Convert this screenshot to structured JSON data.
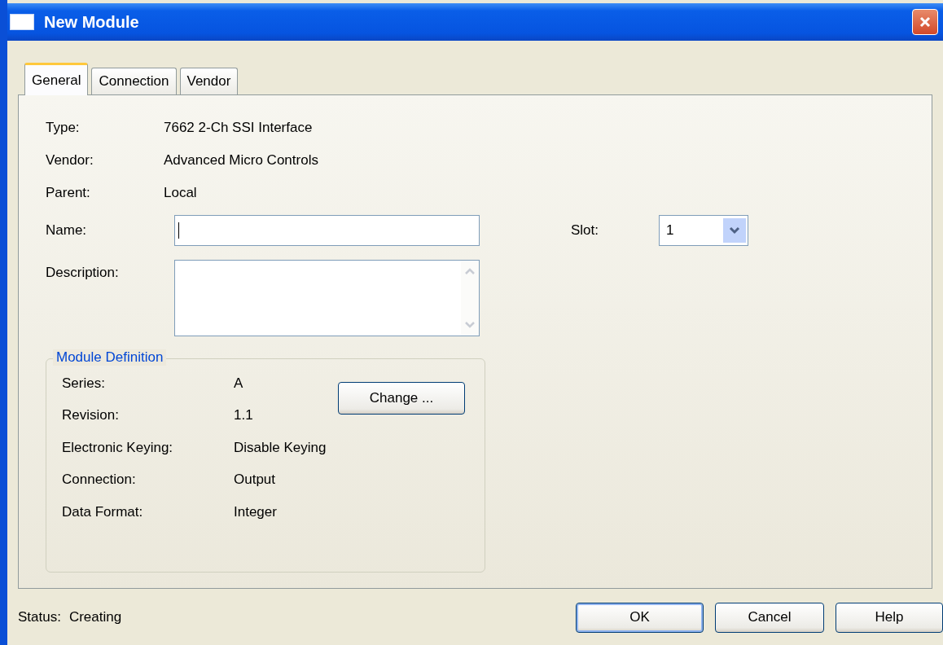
{
  "window": {
    "title": "New Module"
  },
  "tabs": [
    {
      "label": "General",
      "selected": true
    },
    {
      "label": "Connection",
      "selected": false
    },
    {
      "label": "Vendor",
      "selected": false
    }
  ],
  "info": [
    {
      "label": "Type:",
      "value": "7662 2-Ch SSI Interface"
    },
    {
      "label": "Vendor:",
      "value": "Advanced Micro Controls"
    },
    {
      "label": "Parent:",
      "value": "Local"
    }
  ],
  "name_field": {
    "label": "Name:"
  },
  "description_field": {
    "label": "Description:"
  },
  "slot": {
    "label": "Slot:",
    "value": "1"
  },
  "module_definition": {
    "title": "Module Definition",
    "change_button": "Change ...",
    "rows": [
      {
        "label": "Series:",
        "value": "A"
      },
      {
        "label": "Revision:",
        "value": "1.1"
      },
      {
        "label": "Electronic Keying:",
        "value": "Disable Keying"
      },
      {
        "label": "Connection:",
        "value": "Output"
      },
      {
        "label": "Data Format:",
        "value": "Integer"
      }
    ]
  },
  "status": {
    "label": "Status:",
    "value": "Creating"
  },
  "buttons": [
    {
      "label": "OK",
      "default": true
    },
    {
      "label": "Cancel",
      "default": false
    },
    {
      "label": "Help",
      "default": false
    }
  ]
}
